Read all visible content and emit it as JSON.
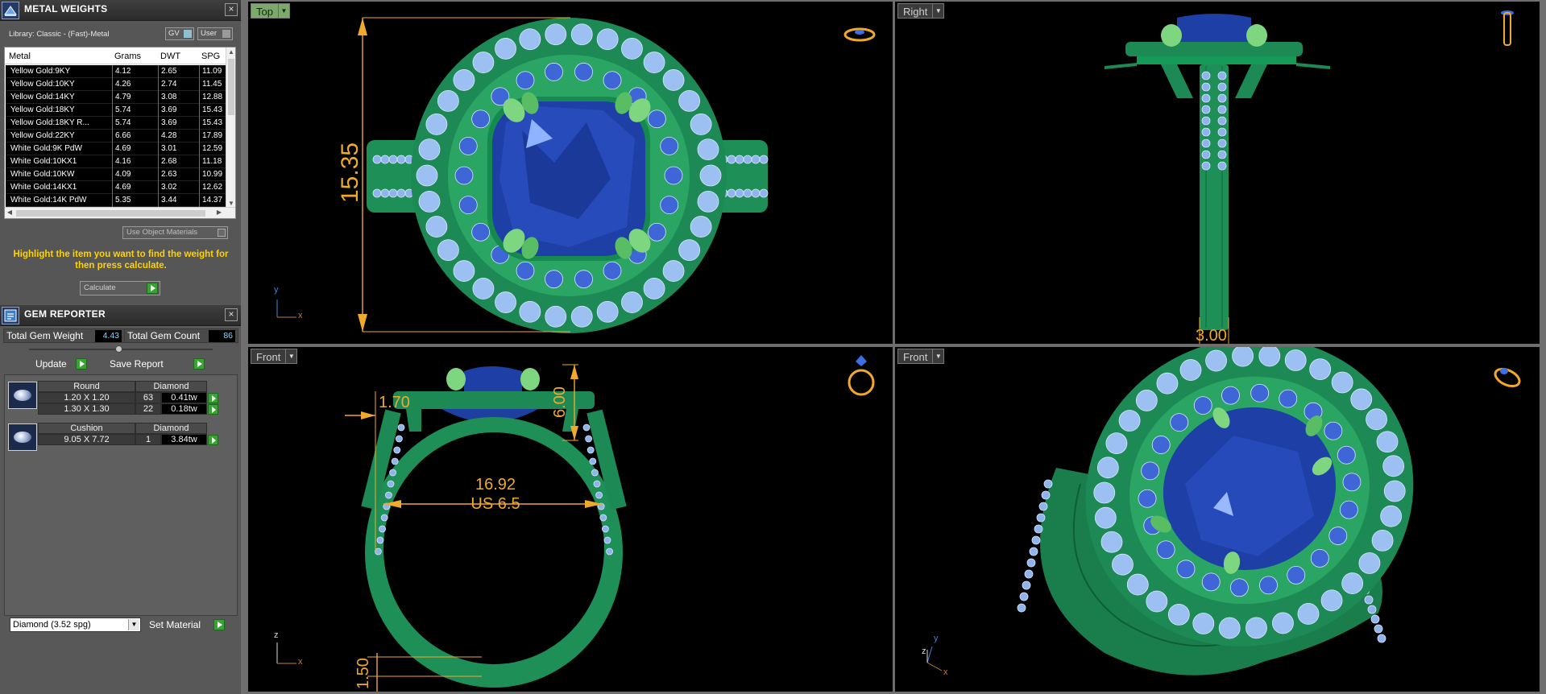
{
  "metal_weights": {
    "title": "METAL WEIGHTS",
    "library_label": "Library: Classic - (Fast)-Metal",
    "gv_button": "GV",
    "user_button": "User",
    "columns": [
      "Metal",
      "Grams",
      "DWT",
      "SPG"
    ],
    "rows": [
      [
        "Yellow Gold:9KY",
        "4.12",
        "2.65",
        "11.09"
      ],
      [
        "Yellow Gold:10KY",
        "4.26",
        "2.74",
        "11.45"
      ],
      [
        "Yellow Gold:14KY",
        "4.79",
        "3.08",
        "12.88"
      ],
      [
        "Yellow Gold:18KY",
        "5.74",
        "3.69",
        "15.43"
      ],
      [
        "Yellow Gold:18KY R...",
        "5.74",
        "3.69",
        "15.43"
      ],
      [
        "Yellow Gold:22KY",
        "6.66",
        "4.28",
        "17.89"
      ],
      [
        "White Gold:9K PdW",
        "4.69",
        "3.01",
        "12.59"
      ],
      [
        "White Gold:10KX1",
        "4.16",
        "2.68",
        "11.18"
      ],
      [
        "White Gold:10KW",
        "4.09",
        "2.63",
        "10.99"
      ],
      [
        "White Gold:14KX1",
        "4.69",
        "3.02",
        "12.62"
      ],
      [
        "White Gold:14K PdW",
        "5.35",
        "3.44",
        "14.37"
      ]
    ],
    "use_object_materials": "Use Object Materials",
    "hint": "Highlight the item you want to find the weight for then press calculate.",
    "calculate_label": "Calculate"
  },
  "gem_reporter": {
    "title": "GEM REPORTER",
    "total_gem_weight_label": "Total Gem Weight",
    "total_gem_weight": "4.43",
    "total_gem_count_label": "Total Gem Count",
    "total_gem_count": "86",
    "update_label": "Update",
    "save_report_label": "Save Report",
    "groups": [
      {
        "shape": "Round",
        "material": "Diamond",
        "items": [
          {
            "size": "1.20 X 1.20",
            "count": "63",
            "weight": "0.41tw"
          },
          {
            "size": "1.30 X 1.30",
            "count": "22",
            "weight": "0.18tw"
          }
        ]
      },
      {
        "shape": "Cushion",
        "material": "Diamond",
        "items": [
          {
            "size": "9.05 X 7.72",
            "count": "1",
            "weight": "3.84tw"
          }
        ]
      }
    ],
    "material_select": "Diamond    (3.52 spg)",
    "set_material_label": "Set Material"
  },
  "viewports": {
    "top": {
      "label": "Top",
      "dimension": "15.35",
      "axis_x": "x",
      "axis_y": "y"
    },
    "right": {
      "label": "Right",
      "dimension": "3.00"
    },
    "front": {
      "label": "Front",
      "dim_top": "6.00",
      "dim_left": "1.70",
      "ring_size_mm": "16.92",
      "ring_size_us": "US 6.5",
      "dim_bottom": "1.50",
      "axis_x": "x",
      "axis_z": "z"
    },
    "perspective": {
      "label": "Front",
      "axis_x": "x",
      "axis_y": "y",
      "axis_z": "z"
    }
  },
  "colors": {
    "dimension": "#f0a92a",
    "metal": "#1f9b5c",
    "sapphire": "#1e3fa6",
    "diamond": "#8fb3ea",
    "panel_hint": "#ffd200"
  }
}
